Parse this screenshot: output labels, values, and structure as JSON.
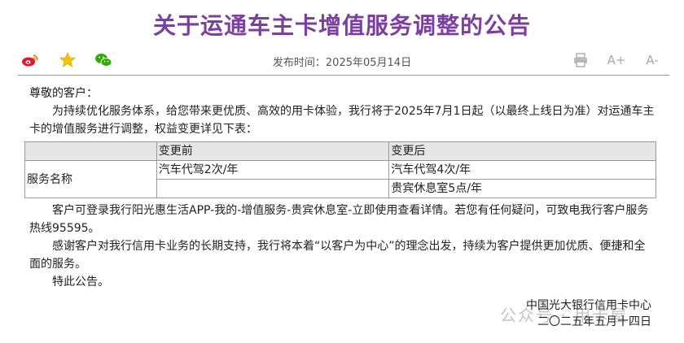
{
  "title": "关于运通车主卡增值服务调整的公告",
  "toolbar": {
    "publish_time": "发布时间：2025年05月14日",
    "share_icons": [
      "weibo-icon",
      "star-icon",
      "wechat-icon"
    ],
    "tool_icons": [
      "print-icon",
      "font-increase-icon",
      "font-decrease-icon"
    ],
    "font_up_label": "A+",
    "font_down_label": "A-"
  },
  "body": {
    "greeting": "尊敬的客户：",
    "intro": "为持续优化服务体系，给您带来更优质、高效的用卡体验，我行将于2025年7月1日起（以最终上线日为准）对运通车主卡的增值服务进行调整，权益变更详见下表：",
    "table": {
      "headers": [
        "",
        "变更前",
        "变更后"
      ],
      "row_label": "服务名称",
      "rows": [
        [
          "汽车代驾2次/年",
          "汽车代驾4次/年"
        ],
        [
          "",
          "贵宾休息室5点/年"
        ]
      ]
    },
    "para2": "客户可登录我行阳光惠生活APP-我的-增值服务-贵宾休息室-立即使用查看详情。若您有任何疑问，可致电我行客户服务热线95595。",
    "para3": "感谢客户对我行信用卡业务的长期支持，我行将本着“以客户为中心”的理念出发，持续为客户提供更加优质、便捷和全面的服务。",
    "para4": "特此公告。"
  },
  "signature": {
    "org": "中国光大银行信用卡中心",
    "date": "二〇二五年五月十四日"
  },
  "watermark": "公众号 · 用卡屋",
  "colors": {
    "title": "#7b3fa0",
    "weibo": "#e6162d",
    "star": "#f5c400",
    "wechat": "#2aae00"
  }
}
